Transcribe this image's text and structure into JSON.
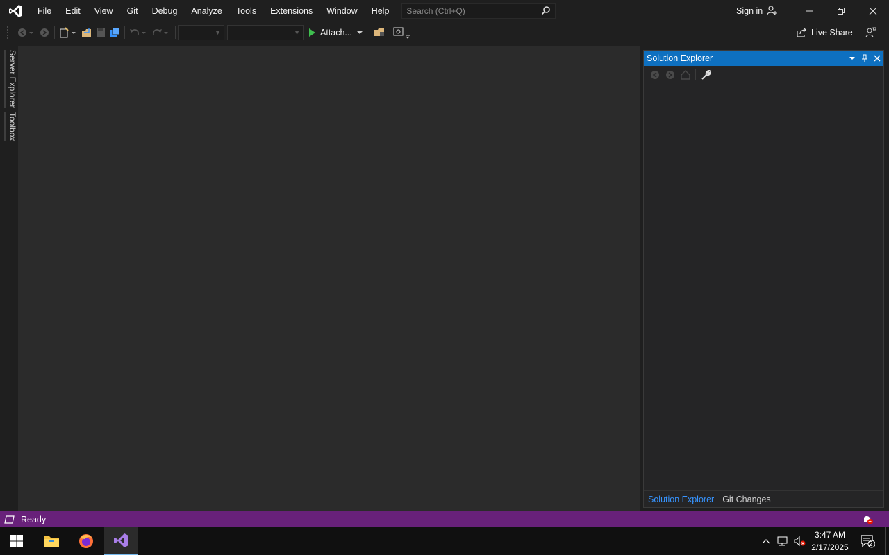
{
  "menu": {
    "items": [
      "File",
      "Edit",
      "View",
      "Git",
      "Debug",
      "Analyze",
      "Tools",
      "Extensions",
      "Window",
      "Help"
    ]
  },
  "search": {
    "placeholder": "Search (Ctrl+Q)"
  },
  "account": {
    "sign_in": "Sign in"
  },
  "toolbar": {
    "attach_label": "Attach...",
    "live_share": "Live Share"
  },
  "side_tabs": {
    "server_explorer": "Server Explorer",
    "toolbox": "Toolbox"
  },
  "solution_explorer": {
    "title": "Solution Explorer",
    "tabs": [
      "Solution Explorer",
      "Git Changes"
    ]
  },
  "status": {
    "text": "Ready",
    "notification_count": "1"
  },
  "taskbar": {
    "apps": [
      "windows-start",
      "file-explorer",
      "firefox",
      "visual-studio"
    ],
    "time": "3:47 AM",
    "date": "2/17/2025",
    "action_center_count": "2"
  },
  "colors": {
    "accent_blue": "#0e70c0",
    "status_purple": "#68217a",
    "vs_purple": "#a97ee8"
  }
}
